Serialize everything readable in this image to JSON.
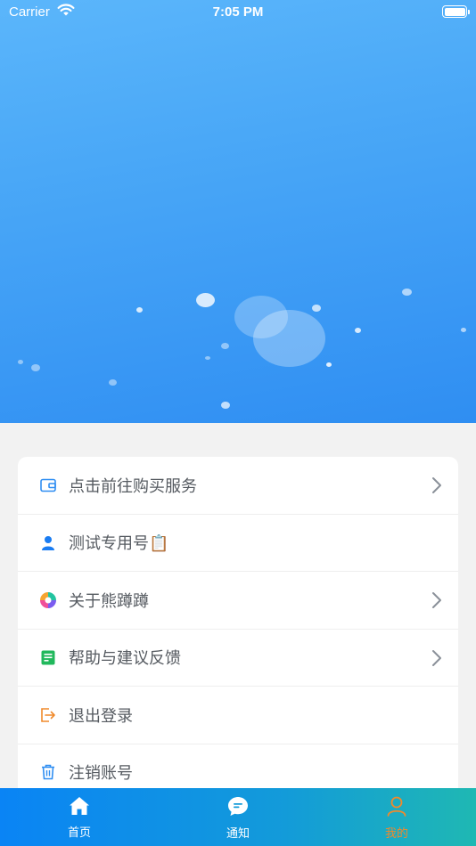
{
  "status_bar": {
    "carrier": "Carrier",
    "time": "7:05 PM"
  },
  "menu": {
    "items": [
      {
        "label": "点击前往购买服务",
        "icon": "wallet-icon",
        "has_chevron": true
      },
      {
        "label": "测试专用号📋",
        "icon": "user-icon",
        "has_chevron": false
      },
      {
        "label": "关于熊蹲蹲",
        "icon": "app-logo-icon",
        "has_chevron": true
      },
      {
        "label": "帮助与建议反馈",
        "icon": "feedback-icon",
        "has_chevron": true
      },
      {
        "label": "退出登录",
        "icon": "logout-icon",
        "has_chevron": false
      },
      {
        "label": "注销账号",
        "icon": "trash-icon",
        "has_chevron": false
      }
    ]
  },
  "tab_bar": {
    "tabs": [
      {
        "label": "首页",
        "icon": "home-icon",
        "active": false
      },
      {
        "label": "通知",
        "icon": "message-icon",
        "active": false
      },
      {
        "label": "我的",
        "icon": "profile-icon",
        "active": true
      }
    ]
  },
  "colors": {
    "accent": "#2f8ef2",
    "active_tab": "#f08a2b",
    "menu_text": "#555a60"
  }
}
